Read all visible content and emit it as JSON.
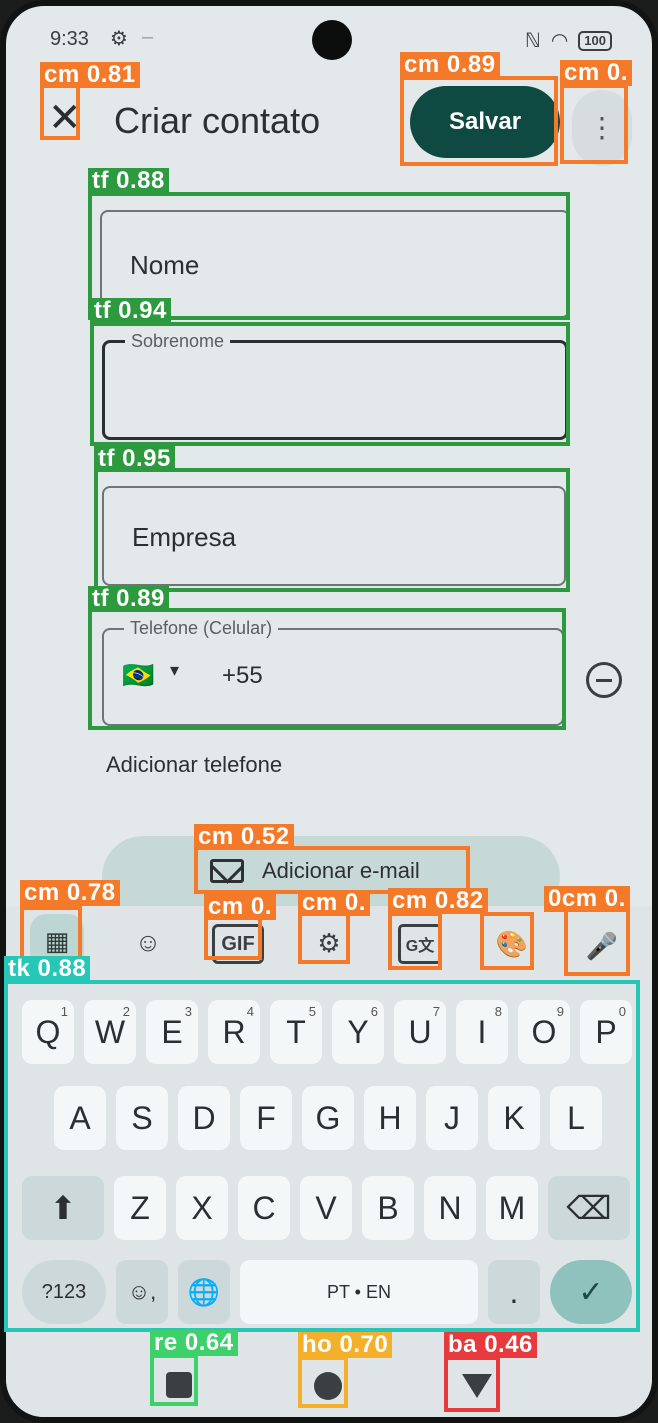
{
  "status": {
    "time": "9:33",
    "battery": "100",
    "status_glyph": "⚙",
    "dash": "–",
    "nfc": "ℕ",
    "wifi": "◠"
  },
  "header": {
    "title": "Criar contato",
    "close_label": "✕",
    "save_label": "Salvar",
    "more_label": "⋮"
  },
  "form": {
    "first_name_placeholder": "Nome",
    "last_name_label": "Sobrenome",
    "company_placeholder": "Empresa",
    "phone_label": "Telefone (Celular)",
    "phone_code": "+55",
    "flag": "🇧🇷",
    "add_phone": "Adicionar telefone",
    "add_email": "Adicionar e-mail"
  },
  "toolbar": {
    "gif": "GIF",
    "grid_icon": "▦",
    "sticker_icon": "☺",
    "settings_icon": "⚙",
    "translate_icon": "G文",
    "palette_icon": "🎨",
    "mic_icon": "🎤"
  },
  "keyboard": {
    "row1": [
      "Q",
      "W",
      "E",
      "R",
      "T",
      "Y",
      "U",
      "I",
      "O",
      "P"
    ],
    "row1_hints": [
      "1",
      "2",
      "3",
      "4",
      "5",
      "6",
      "7",
      "8",
      "9",
      "0"
    ],
    "row2": [
      "A",
      "S",
      "D",
      "F",
      "G",
      "H",
      "J",
      "K",
      "L"
    ],
    "row3": [
      "Z",
      "X",
      "C",
      "V",
      "B",
      "N",
      "M"
    ],
    "shift": "⬆",
    "backspace": "⌫",
    "symbols": "?123",
    "emoji_comma": "☺,",
    "globe": "🌐",
    "space": "PT • EN",
    "period": ".",
    "enter": "✓"
  },
  "overlays": [
    {
      "tag": "cm",
      "score": "0.81"
    },
    {
      "tag": "cm",
      "score": "0.89"
    },
    {
      "tag": "cm",
      "score": "0."
    },
    {
      "tag": "tf",
      "score": "0.88"
    },
    {
      "tag": "tf",
      "score": "0.94"
    },
    {
      "tag": "tf",
      "score": "0.95"
    },
    {
      "tag": "tf",
      "score": "0.89"
    },
    {
      "tag": "cm",
      "score": "0.52"
    },
    {
      "tag": "cm",
      "score": "0.78"
    },
    {
      "tag": "cm",
      "score": "0."
    },
    {
      "tag": "cm",
      "score": "0."
    },
    {
      "tag": "cm",
      "score": "0.82"
    },
    {
      "tag": "0cm",
      "score": "0."
    },
    {
      "tag": "tk",
      "score": "0.88"
    },
    {
      "tag": "re",
      "score": "0.64"
    },
    {
      "tag": "ho",
      "score": "0.70"
    },
    {
      "tag": "ba",
      "score": "0.46"
    }
  ]
}
